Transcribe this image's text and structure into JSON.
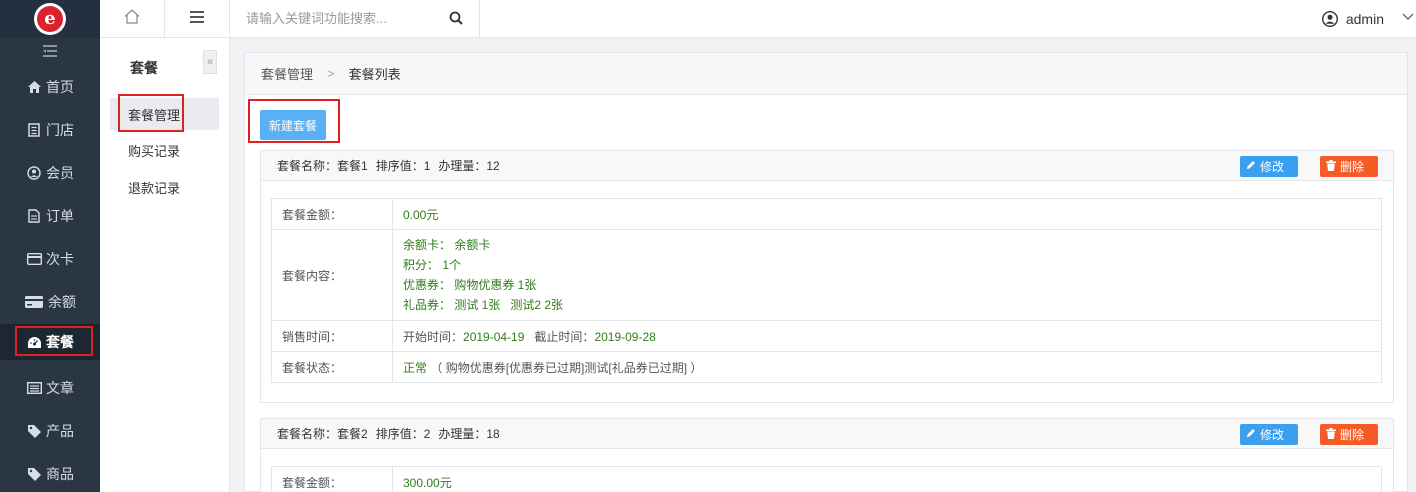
{
  "header": {
    "search_placeholder": "请输入关键词功能搜索...",
    "username": "admin"
  },
  "sidebar": {
    "items": [
      {
        "label": "首页",
        "icon": "home-icon"
      },
      {
        "label": "门店",
        "icon": "store-icon"
      },
      {
        "label": "会员",
        "icon": "member-icon"
      },
      {
        "label": "订单",
        "icon": "order-icon"
      },
      {
        "label": "次卡",
        "icon": "card-icon"
      },
      {
        "label": "余额",
        "icon": "balance-icon"
      },
      {
        "label": "套餐",
        "icon": "dashboard-icon",
        "active": true
      },
      {
        "label": "文章",
        "icon": "article-icon"
      },
      {
        "label": "产品",
        "icon": "tag-icon"
      },
      {
        "label": "商品",
        "icon": "tag-icon"
      }
    ]
  },
  "subsidebar": {
    "title": "套餐",
    "items": [
      {
        "label": "套餐管理",
        "active": true
      },
      {
        "label": "购买记录"
      },
      {
        "label": "退款记录"
      }
    ]
  },
  "breadcrumb": {
    "parent": "套餐管理",
    "current": "套餐列表"
  },
  "new_button": "新建套餐",
  "actions": {
    "edit": "修改",
    "delete": "删除"
  },
  "packages": [
    {
      "head": {
        "name": "套餐名称：套餐1",
        "sort": "排序值：1",
        "count": "办理量：12"
      },
      "amount_label": "套餐金额：",
      "amount": "0.00元",
      "content_label": "套餐内容：",
      "content_lines": [
        "余额卡： 余额卡",
        "积分： 1个",
        "优惠券： 购物优惠券 1张",
        "礼品券： 测试 1张   测试2 2张"
      ],
      "sale_label": "销售时间：",
      "sale_start_label": "开始时间：",
      "sale_start": "2019-04-19",
      "sale_end_label": "截止时间：",
      "sale_end": "2019-09-28",
      "status_label": "套餐状态：",
      "status": "正常",
      "status_note": "（ 购物优惠券[优惠券已过期]测试[礼品券已过期] ）"
    },
    {
      "head": {
        "name": "套餐名称：套餐2",
        "sort": "排序值：2",
        "count": "办理量：18"
      },
      "amount_label": "套餐金额：",
      "amount": "300.00元"
    }
  ],
  "colors": {
    "sidebar_bg": "#2b3643",
    "accent_blue": "#5ab0f5",
    "edit_blue": "#3b9ff0",
    "delete_orange": "#f55b26",
    "value_green": "#2f7d1b",
    "highlight_red": "#e02020"
  }
}
